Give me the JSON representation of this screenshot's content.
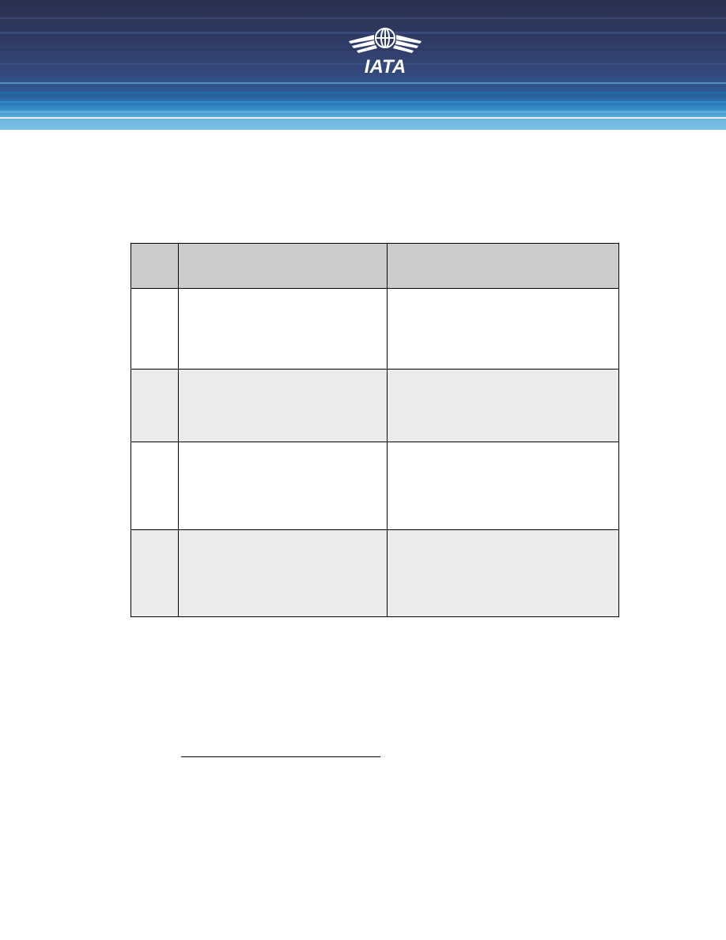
{
  "header": {
    "logo_text": "IATA",
    "colors": {
      "navy": "#2a3050",
      "blue": "#2a7ab8",
      "light_blue": "#7cc0e4",
      "logo_white": "#ffffff"
    }
  },
  "table": {
    "columns": [
      "",
      "",
      ""
    ],
    "rows": [
      [
        "",
        "",
        ""
      ],
      [
        "",
        "",
        ""
      ],
      [
        "",
        "",
        ""
      ],
      [
        "",
        "",
        ""
      ]
    ],
    "colors": {
      "header_fill": "#cccccc",
      "shaded_row_fill": "#ebebeb"
    }
  }
}
